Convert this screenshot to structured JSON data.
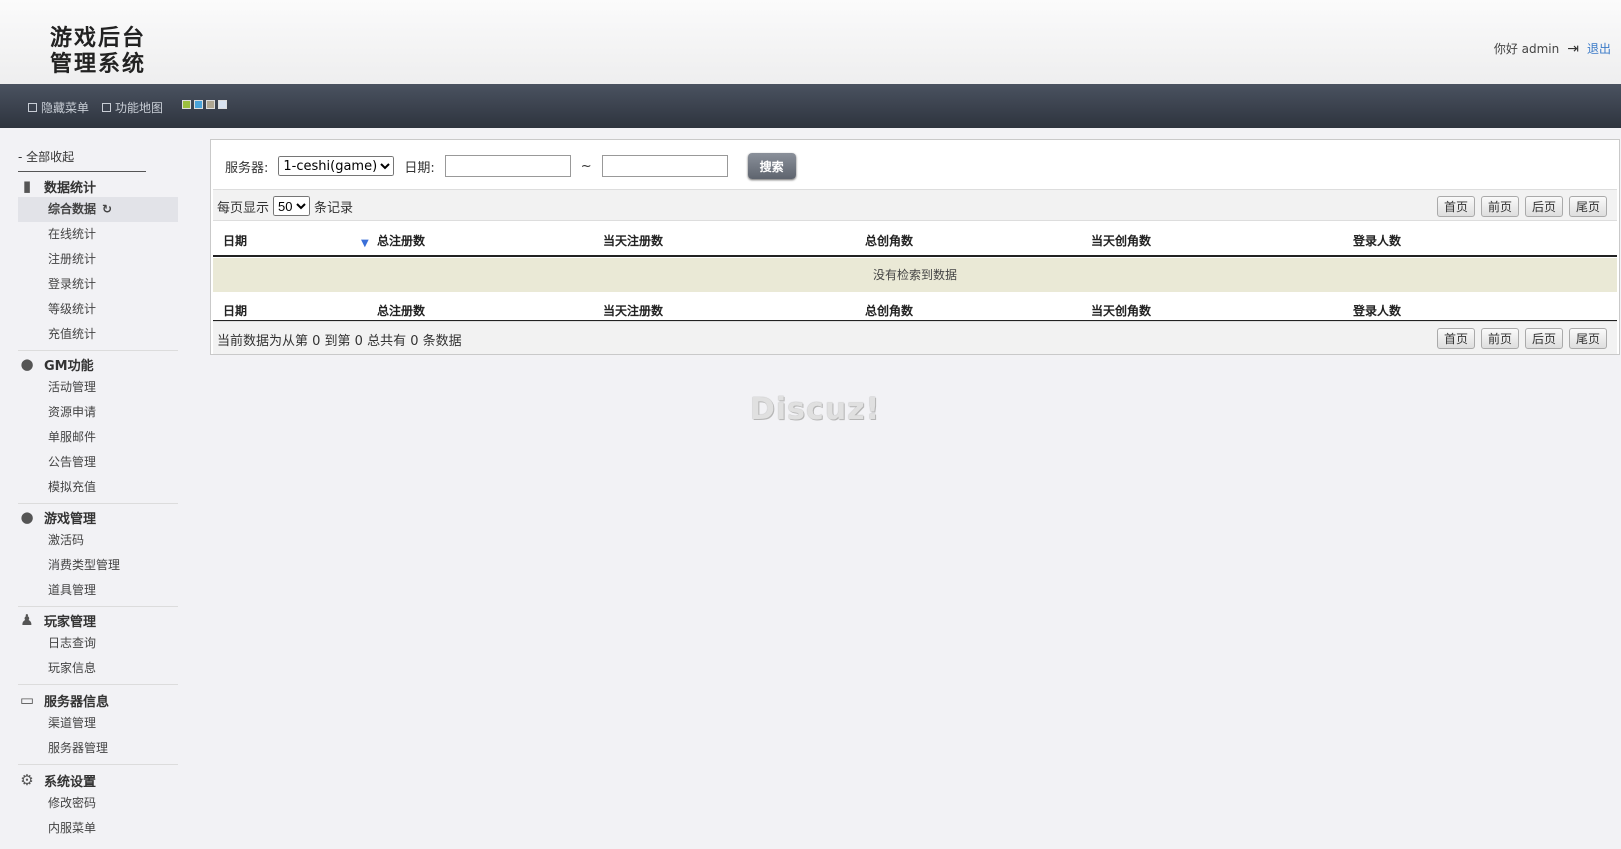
{
  "header": {
    "logo_line1": "游戏后台",
    "logo_line2": "管理系统",
    "greeting": "你好 admin",
    "logout": "退出"
  },
  "navbar": {
    "hide_menu": "隐藏菜单",
    "function_map": "功能地图",
    "skin_colors": [
      "#9bbf3e",
      "#4aa3d9",
      "#b0a792",
      "#d9e3f0"
    ]
  },
  "sidebar": {
    "collapse_all": "- 全部收起",
    "groups": [
      {
        "title": "数据统计",
        "icon": "bar-chart-icon",
        "items": [
          "综合数据",
          "在线统计",
          "注册统计",
          "登录统计",
          "等级统计",
          "充值统计"
        ]
      },
      {
        "title": "GM功能",
        "icon": "bubbles-icon",
        "items": [
          "活动管理",
          "资源申请",
          "单服邮件",
          "公告管理",
          "模拟充值"
        ]
      },
      {
        "title": "游戏管理",
        "icon": "bubbles-icon",
        "items": [
          "激活码",
          "消费类型管理",
          "道具管理"
        ]
      },
      {
        "title": "玩家管理",
        "icon": "user-icon",
        "items": [
          "日志查询",
          "玩家信息"
        ]
      },
      {
        "title": "服务器信息",
        "icon": "monitor-icon",
        "items": [
          "渠道管理",
          "服务器管理"
        ]
      },
      {
        "title": "系统设置",
        "icon": "gear-icon",
        "items": [
          "修改密码",
          "内服菜单"
        ]
      }
    ]
  },
  "filter": {
    "server_label": "服务器:",
    "server_value": "1-ceshi(game)",
    "date_label": "日期:",
    "tilde": "~",
    "search_button": "搜索"
  },
  "table": {
    "per_page_prefix": "每页显示",
    "per_page_value": "50",
    "per_page_suffix": "条记录",
    "pager": [
      "首页",
      "前页",
      "后页",
      "尾页"
    ],
    "columns": [
      "日期",
      "总注册数",
      "当天注册数",
      "总创角数",
      "当天创角数",
      "登录人数"
    ],
    "empty_message": "没有检索到数据",
    "summary": "当前数据为从第 0 到第 0 总共有 0 条数据"
  },
  "watermark": "Discuz!"
}
